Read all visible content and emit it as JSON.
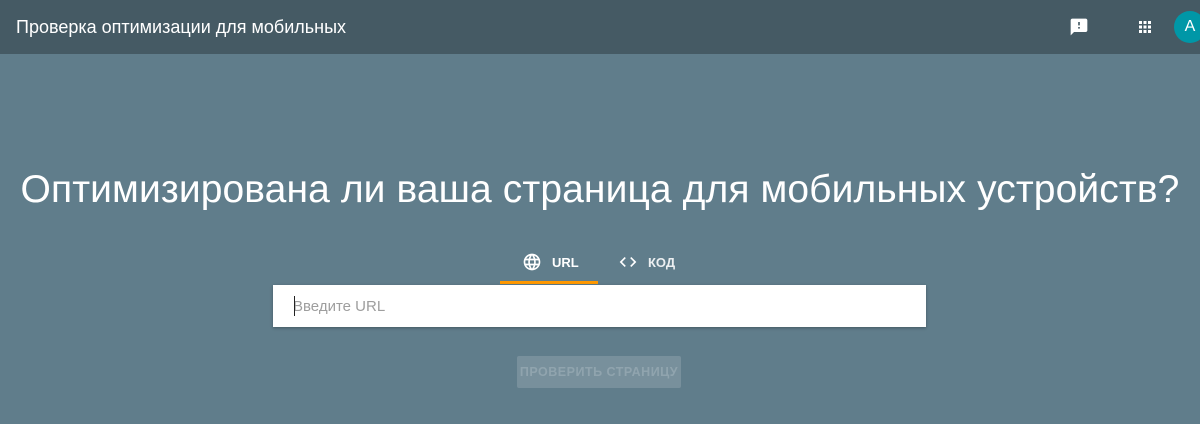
{
  "header": {
    "title": "Проверка оптимизации для мобильных",
    "avatar_letter": "A",
    "icons": [
      "feedback-icon",
      "apps-grid-icon"
    ]
  },
  "main": {
    "headline": "Оптимизирована ли ваша страница для мобильных устройств?",
    "tabs": [
      {
        "label": "URL",
        "icon": "globe-icon",
        "active": true
      },
      {
        "label": "КОД",
        "icon": "code-icon",
        "active": false
      }
    ],
    "url_input": {
      "placeholder": "Введите URL",
      "value": ""
    },
    "submit_label": "ПРОВЕРИТЬ СТРАНИЦУ"
  },
  "colors": {
    "background": "#607d8b",
    "topbar": "#455a64",
    "tab_indicator": "#ff9800",
    "avatar": "#0097a7"
  }
}
